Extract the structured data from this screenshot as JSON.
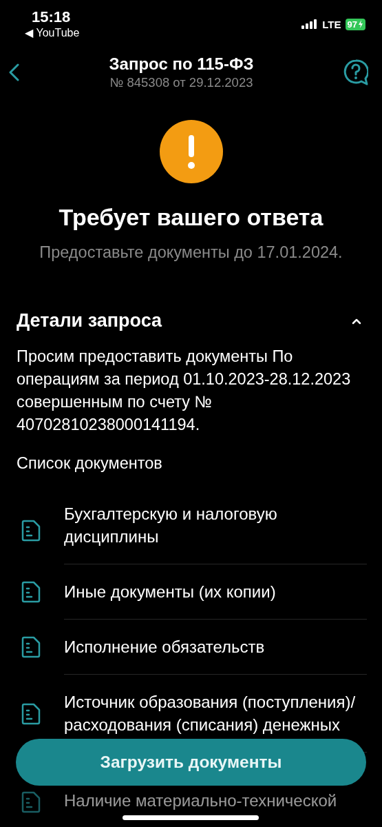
{
  "status_bar": {
    "time": "15:18",
    "back_app": "◀ YouTube",
    "network": "LTE",
    "battery": "97"
  },
  "header": {
    "title": "Запрос по 115-ФЗ",
    "subtitle": "№ 845308 от 29.12.2023"
  },
  "status": {
    "title": "Требует вашего ответа",
    "subtitle": "Предоставьте документы до 17.01.2024."
  },
  "details": {
    "title": "Детали запроса",
    "expanded": true,
    "text": "Просим предоставить документы По операциям за период 01.10.2023-28.12.2023 совершенным по счету № 40702810238000141194.",
    "list_title": "Список документов"
  },
  "documents": [
    {
      "label": "Бухгалтерскую и налоговую дисциплины",
      "dimmed": false
    },
    {
      "label": "Иные документы (их копии)",
      "dimmed": false
    },
    {
      "label": "Исполнение обязательств",
      "dimmed": false
    },
    {
      "label": "Источник образования (поступления)/ расходования (списания) денежных",
      "dimmed": false
    },
    {
      "label": "Наличие материально-технической",
      "dimmed": true
    }
  ],
  "upload_button": "Загрузить документы"
}
